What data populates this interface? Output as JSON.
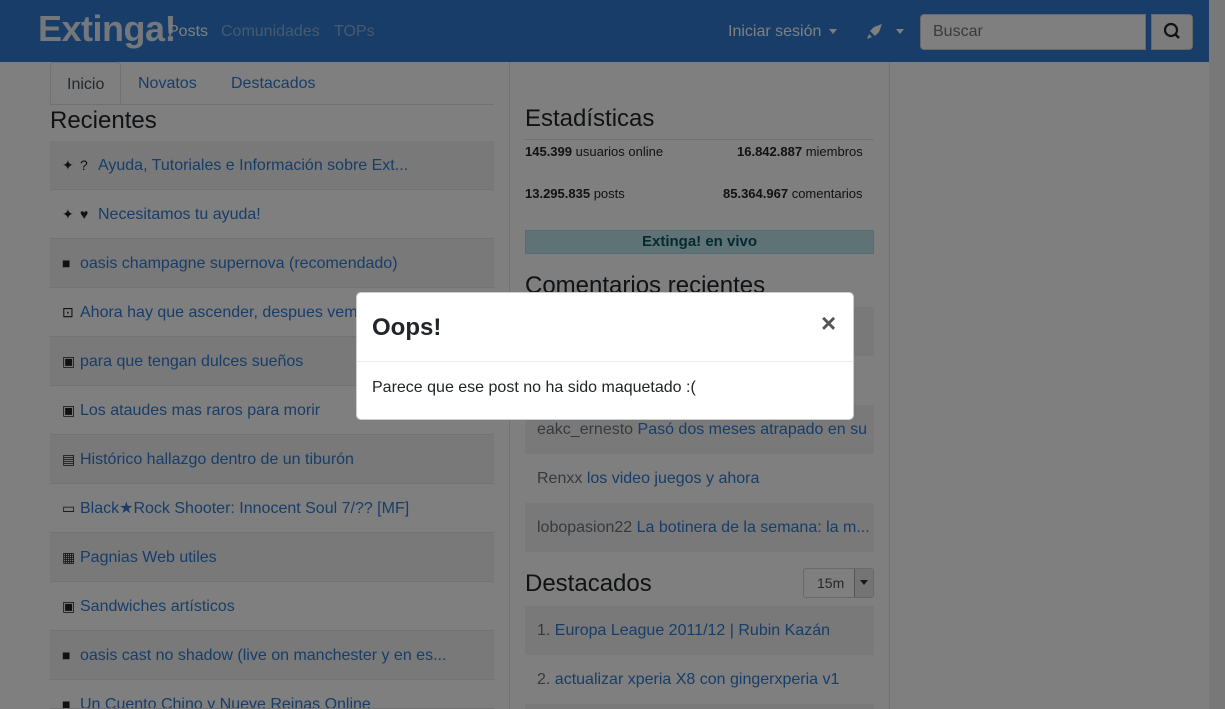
{
  "header": {
    "brand": "Extinga!",
    "nav": [
      "Posts",
      "Comunidades",
      "TOPs"
    ],
    "login": "Iniciar sesión",
    "search_placeholder": "Buscar",
    "brand_color": "#2e7bd1"
  },
  "tabs": [
    "Inicio",
    "Novatos",
    "Destacados"
  ],
  "recientes": {
    "title": "Recientes",
    "items": [
      {
        "icon": "pin-question-icon",
        "glyph": "📌?",
        "text": "Ayuda, Tutoriales e Información sobre Ext..."
      },
      {
        "icon": "pin-heart-icon",
        "glyph": "📌♥",
        "text": "Necesitamos tu ayuda!"
      },
      {
        "icon": "video-icon",
        "glyph": "■",
        "text": "oasis champagne supernova (recomendado)"
      },
      {
        "icon": "robot-icon",
        "glyph": "⊡",
        "text": "Ahora hay que ascender, despues vemo"
      },
      {
        "icon": "image-icon",
        "glyph": "▣",
        "text": "para que tengan dulces sueños"
      },
      {
        "icon": "image-icon",
        "glyph": "▣",
        "text": "Los ataudes mas raros para morir"
      },
      {
        "icon": "text-icon",
        "glyph": "▤",
        "text": "Histórico hallazgo dentro de un tiburón"
      },
      {
        "icon": "chat-icon",
        "glyph": "▭",
        "text": "Black★Rock Shooter: Innocent Soul 7/?? [MF]"
      },
      {
        "icon": "newspaper-icon",
        "glyph": "▦",
        "text": "Pagnias Web utiles"
      },
      {
        "icon": "image-icon",
        "glyph": "▣",
        "text": "Sandwiches artísticos"
      },
      {
        "icon": "video-icon",
        "glyph": "■",
        "text": "oasis cast no shadow (live on manchester y en es..."
      },
      {
        "icon": "video-icon",
        "glyph": "■",
        "text": "Un Cuento Chino y Nueve Reinas Online"
      }
    ]
  },
  "estadisticas": {
    "title": "Estadísticas",
    "online_value": "145.399",
    "online_label": "usuarios online",
    "members_value": "16.842.887",
    "members_label": "miembros",
    "posts_value": "13.295.835",
    "posts_label": "posts",
    "comments_value": "85.364.967",
    "comments_label": "comentarios",
    "live": "Extinga! en vivo"
  },
  "comentarios": {
    "title": "Comentarios recientes",
    "items": [
      {
        "user": "",
        "text": "...",
        "visible": "partial"
      },
      {
        "user": "eakc_ernesto",
        "text": "Pasó dos meses atrapado en su"
      },
      {
        "user": "Renxx",
        "text": "los video juegos y ahora"
      },
      {
        "user": "lobopasion22",
        "text": "La botinera de la semana: la m..."
      }
    ]
  },
  "destacados": {
    "title": "Destacados",
    "period": "15m",
    "items": [
      {
        "num": "1.",
        "text": "Europa League 2011/12 | Rubin Kazán"
      },
      {
        "num": "2.",
        "text": "actualizar xperia X8 con gingerxperia v1"
      }
    ]
  },
  "modal": {
    "title": "Oops!",
    "close": "×",
    "body": "Parece que ese post no ha sido maquetado :("
  }
}
